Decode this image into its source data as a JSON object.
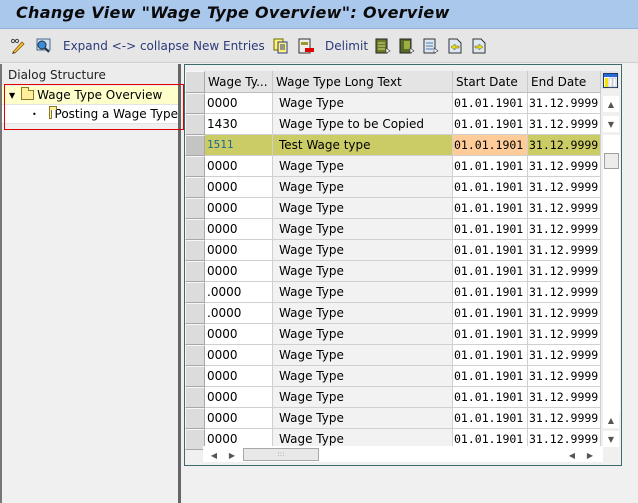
{
  "window": {
    "title": "Change View \"Wage Type Overview\": Overview"
  },
  "toolbar": {
    "items": [
      {
        "icon": "pencil-glasses-icon"
      },
      {
        "icon": "find-icon"
      },
      {
        "label": "Expand <-> collapse"
      },
      {
        "label": "New Entries"
      },
      {
        "icon": "copy-as-icon"
      },
      {
        "icon": "delete-icon"
      },
      {
        "label": "Delimit"
      },
      {
        "icon": "select-all-icon"
      },
      {
        "icon": "select-block-icon"
      },
      {
        "icon": "deselect-all-icon"
      },
      {
        "icon": "previous-entry-icon"
      },
      {
        "icon": "next-entry-icon"
      }
    ]
  },
  "dialog_structure": {
    "heading": "Dialog Structure",
    "nodes": [
      {
        "label": "Wage Type Overview",
        "expanded": true,
        "selected": true
      },
      {
        "label": "Posting a Wage Type",
        "level": 2
      }
    ]
  },
  "table": {
    "columns": [
      "Wage Ty...",
      "Wage Type Long Text",
      "Start Date",
      "End Date"
    ],
    "rows": [
      {
        "code": "0000",
        "text": "Wage Type",
        "start": "01.01.1901",
        "end": "31.12.9999"
      },
      {
        "code": "1430",
        "text": "Wage Type to be Copied",
        "start": "01.01.1901",
        "end": "31.12.9999"
      },
      {
        "code": "1511",
        "text": "Test Wage type",
        "start": "01.01.1901",
        "end": "31.12.9999",
        "highlighted": true
      },
      {
        "code": "0000",
        "text": "Wage Type",
        "start": "01.01.1901",
        "end": "31.12.9999"
      },
      {
        "code": "0000",
        "text": "Wage Type",
        "start": "01.01.1901",
        "end": "31.12.9999"
      },
      {
        "code": "0000",
        "text": "Wage Type",
        "start": "01.01.1901",
        "end": "31.12.9999"
      },
      {
        "code": "0000",
        "text": "Wage Type",
        "start": "01.01.1901",
        "end": "31.12.9999"
      },
      {
        "code": "0000",
        "text": "Wage Type",
        "start": "01.01.1901",
        "end": "31.12.9999"
      },
      {
        "code": "0000",
        "text": "Wage Type",
        "start": "01.01.1901",
        "end": "31.12.9999"
      },
      {
        "code": ".0000",
        "text": "Wage Type",
        "start": "01.01.1901",
        "end": "31.12.9999"
      },
      {
        "code": ".0000",
        "text": "Wage Type",
        "start": "01.01.1901",
        "end": "31.12.9999"
      },
      {
        "code": "0000",
        "text": "Wage Type",
        "start": "01.01.1901",
        "end": "31.12.9999"
      },
      {
        "code": "0000",
        "text": "Wage Type",
        "start": "01.01.1901",
        "end": "31.12.9999"
      },
      {
        "code": "0000",
        "text": "Wage Type",
        "start": "01.01.1901",
        "end": "31.12.9999"
      },
      {
        "code": "0000",
        "text": "Wage Type",
        "start": "01.01.1901",
        "end": "31.12.9999"
      },
      {
        "code": "0000",
        "text": "Wage Type",
        "start": "01.01.1901",
        "end": "31.12.9999"
      },
      {
        "code": "0000",
        "text": "Wage Type",
        "start": "01.01.1901",
        "end": "31.12.9999"
      }
    ]
  },
  "colors": {
    "highlight_row": "#cccc66",
    "highlight_start": "#ffcc99",
    "title_bar": "#a9c8ec"
  }
}
